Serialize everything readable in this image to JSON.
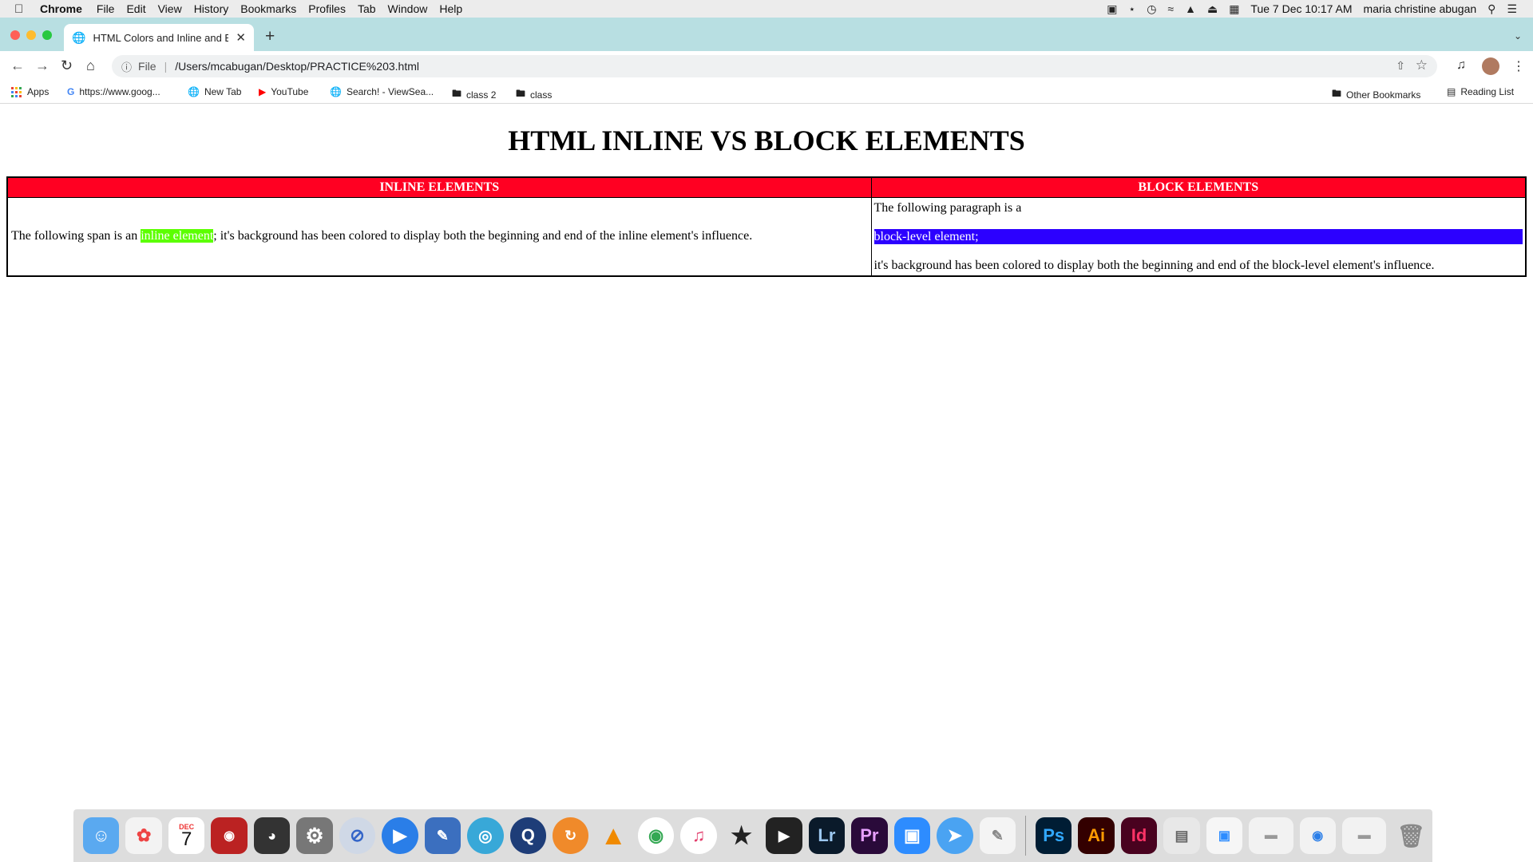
{
  "menubar": {
    "app_name": "Chrome",
    "items": [
      "File",
      "Edit",
      "View",
      "History",
      "Bookmarks",
      "Profiles",
      "Tab",
      "Window",
      "Help"
    ],
    "clock": "Tue 7 Dec  10:17 AM",
    "user": "maria christine abugan"
  },
  "tab": {
    "title": "HTML Colors and Inline and Block"
  },
  "address": {
    "scheme": "File",
    "url": "/Users/mcabugan/Desktop/PRACTICE%203.html"
  },
  "bookmarks": {
    "apps": "Apps",
    "google": "https://www.goog...",
    "new_tab": "New Tab",
    "youtube": "YouTube",
    "search": "Search! - ViewSea...",
    "class2": "class 2",
    "class": "class",
    "other": "Other Bookmarks",
    "reading": "Reading List"
  },
  "page": {
    "heading": "HTML INLINE VS BLOCK ELEMENTS",
    "inline_header": "INLINE ELEMENTS",
    "block_header": "BLOCK ELEMENTS",
    "inline_before": "The following span is an ",
    "inline_span": "inline element",
    "inline_after": "; it's background has been colored to display both the beginning and end of the inline element's influence.",
    "block_p1": "The following paragraph is a",
    "block_p2": "block-level element;",
    "block_p3": "it's background has been colored to display both the beginning and end of the block-level element's influence."
  },
  "colors": {
    "header_red": "#ff0022",
    "inline_green": "#5cff00",
    "block_blue": "#2c00ff",
    "tabstrip": "#b8dfe2"
  },
  "dock": {
    "lightroom": "Lr",
    "premiere": "Pr",
    "photoshop": "Ps",
    "illustrator": "Ai",
    "indesign": "Id",
    "calendar_month": "DEC",
    "calendar_day": "7"
  }
}
